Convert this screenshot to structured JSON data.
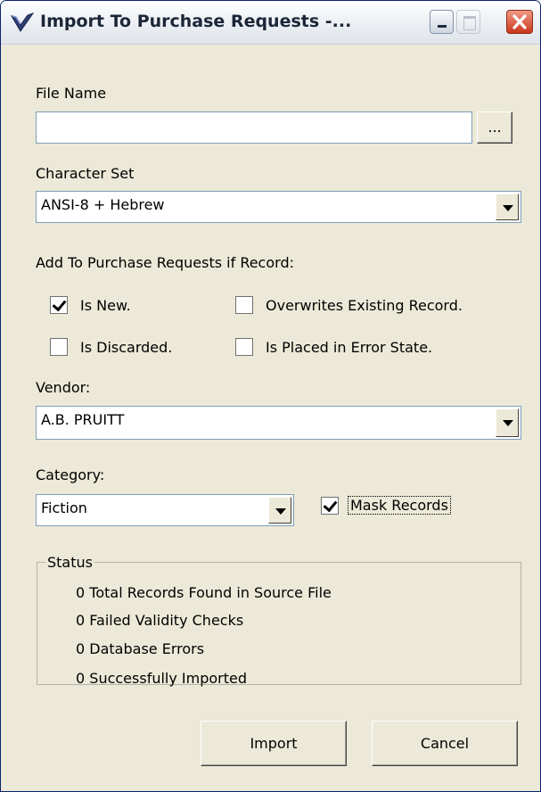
{
  "window": {
    "title": "Import To Purchase Requests -...",
    "icon": "v-checkmark-icon"
  },
  "file_name": {
    "label": "File Name",
    "value": "",
    "browse_label": "..."
  },
  "character_set": {
    "label": "Character Set",
    "selected": "ANSI-8 + Hebrew"
  },
  "add_section": {
    "label": "Add To Purchase Requests if Record:",
    "options": [
      {
        "label": "Is New.",
        "checked": true
      },
      {
        "label": "Overwrites Existing Record.",
        "checked": false
      },
      {
        "label": "Is Discarded.",
        "checked": false
      },
      {
        "label": "Is Placed in Error State.",
        "checked": false
      }
    ]
  },
  "vendor": {
    "label": "Vendor:",
    "selected": "A.B. PRUITT"
  },
  "category": {
    "label": "Category:",
    "selected": "Fiction"
  },
  "mask_records": {
    "label": "Mask Records",
    "checked": true
  },
  "status": {
    "title": "Status",
    "lines": [
      {
        "count": "0",
        "text": "Total Records Found in Source File"
      },
      {
        "count": "0",
        "text": "Failed Validity Checks"
      },
      {
        "count": "0",
        "text": "Database Errors"
      },
      {
        "count": "0",
        "text": "Successfully Imported"
      }
    ]
  },
  "buttons": {
    "import": "Import",
    "cancel": "Cancel"
  }
}
